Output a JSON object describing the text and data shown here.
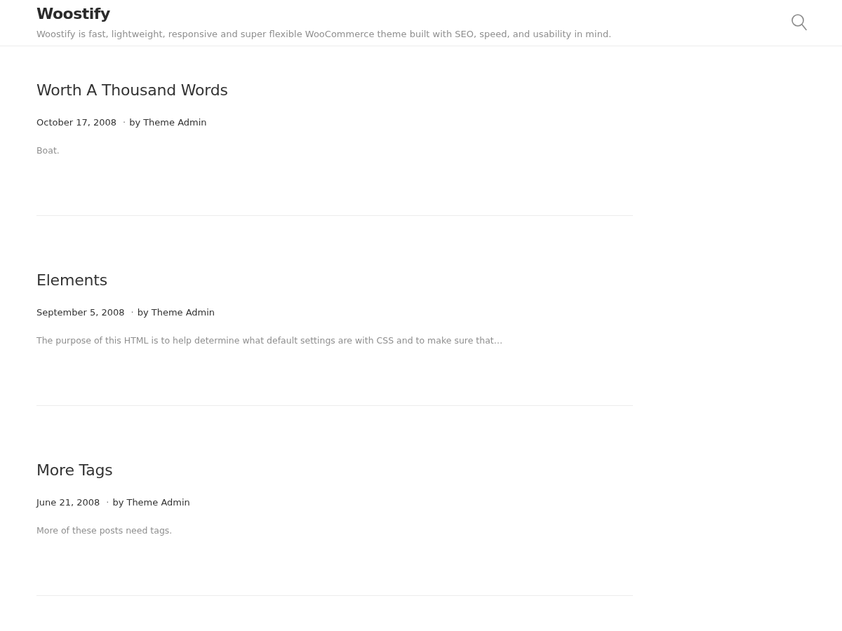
{
  "header": {
    "site_title": "Woostify",
    "tagline": "Woostify is fast, lightweight, responsive and super flexible WooCommerce theme built with SEO, speed, and usability in mind."
  },
  "posts": [
    {
      "title": "Worth A Thousand Words",
      "date": "October 17, 2008",
      "separator": "·",
      "byline": "by",
      "author": "Theme Admin",
      "excerpt": "Boat."
    },
    {
      "title": "Elements",
      "date": "September 5, 2008",
      "separator": "·",
      "byline": "by",
      "author": "Theme Admin",
      "excerpt": "The purpose of this HTML is to help determine what default settings are with CSS and to make sure that…"
    },
    {
      "title": "More Tags",
      "date": "June 21, 2008",
      "separator": "·",
      "byline": "by",
      "author": "Theme Admin",
      "excerpt": "More of these posts need tags."
    }
  ]
}
